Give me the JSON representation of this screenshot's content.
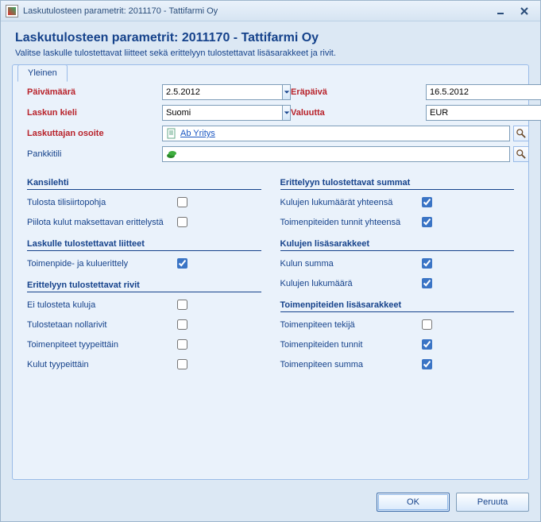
{
  "window": {
    "title": "Laskutulosteen parametrit: 2011170 - Tattifarmi Oy"
  },
  "header": {
    "title": "Laskutulosteen parametrit: 2011170 - Tattifarmi Oy",
    "subtitle": "Valitse laskulle tulostettavat liitteet sekä erittelyyn tulostettavat lisäsarakkeet ja rivit."
  },
  "tab": {
    "label": "Yleinen"
  },
  "form": {
    "date_label": "Päivämäärä",
    "date_value": "2.5.2012",
    "due_label": "Eräpäivä",
    "due_value": "16.5.2012",
    "lang_label": "Laskun kieli",
    "lang_value": "Suomi",
    "currency_label": "Valuutta",
    "currency_value": "EUR",
    "biller_addr_label": "Laskuttajan osoite",
    "biller_addr_value": "Ab Yritys",
    "bank_label": "Pankkitili",
    "bank_value": ""
  },
  "left": {
    "cover": {
      "heading": "Kansilehti",
      "row1": "Tulosta tilisiirtopohja",
      "row2": "Piilota kulut maksettavan erittelystä"
    },
    "attachments": {
      "heading": "Laskulle tulostettavat liitteet",
      "row1": "Toimenpide- ja kuluerittely"
    },
    "rows": {
      "heading": "Erittelyyn tulostettavat rivit",
      "row1": "Ei tulosteta kuluja",
      "row2": "Tulostetaan nollarivit",
      "row3": "Toimenpiteet tyypeittäin",
      "row4": "Kulut tyypeittäin"
    }
  },
  "right": {
    "sums": {
      "heading": "Erittelyyn tulostettavat summat",
      "row1": "Kulujen lukumäärät yhteensä",
      "row2": "Toimenpiteiden tunnit yhteensä"
    },
    "expense_cols": {
      "heading": "Kulujen lisäsarakkeet",
      "row1": "Kulun summa",
      "row2": "Kulujen lukumäärä"
    },
    "action_cols": {
      "heading": "Toimenpiteiden lisäsarakkeet",
      "row1": "Toimenpiteen tekijä",
      "row2": "Toimenpiteiden tunnit",
      "row3": "Toimenpiteen summa"
    }
  },
  "footer": {
    "ok": "OK",
    "cancel": "Peruuta"
  }
}
